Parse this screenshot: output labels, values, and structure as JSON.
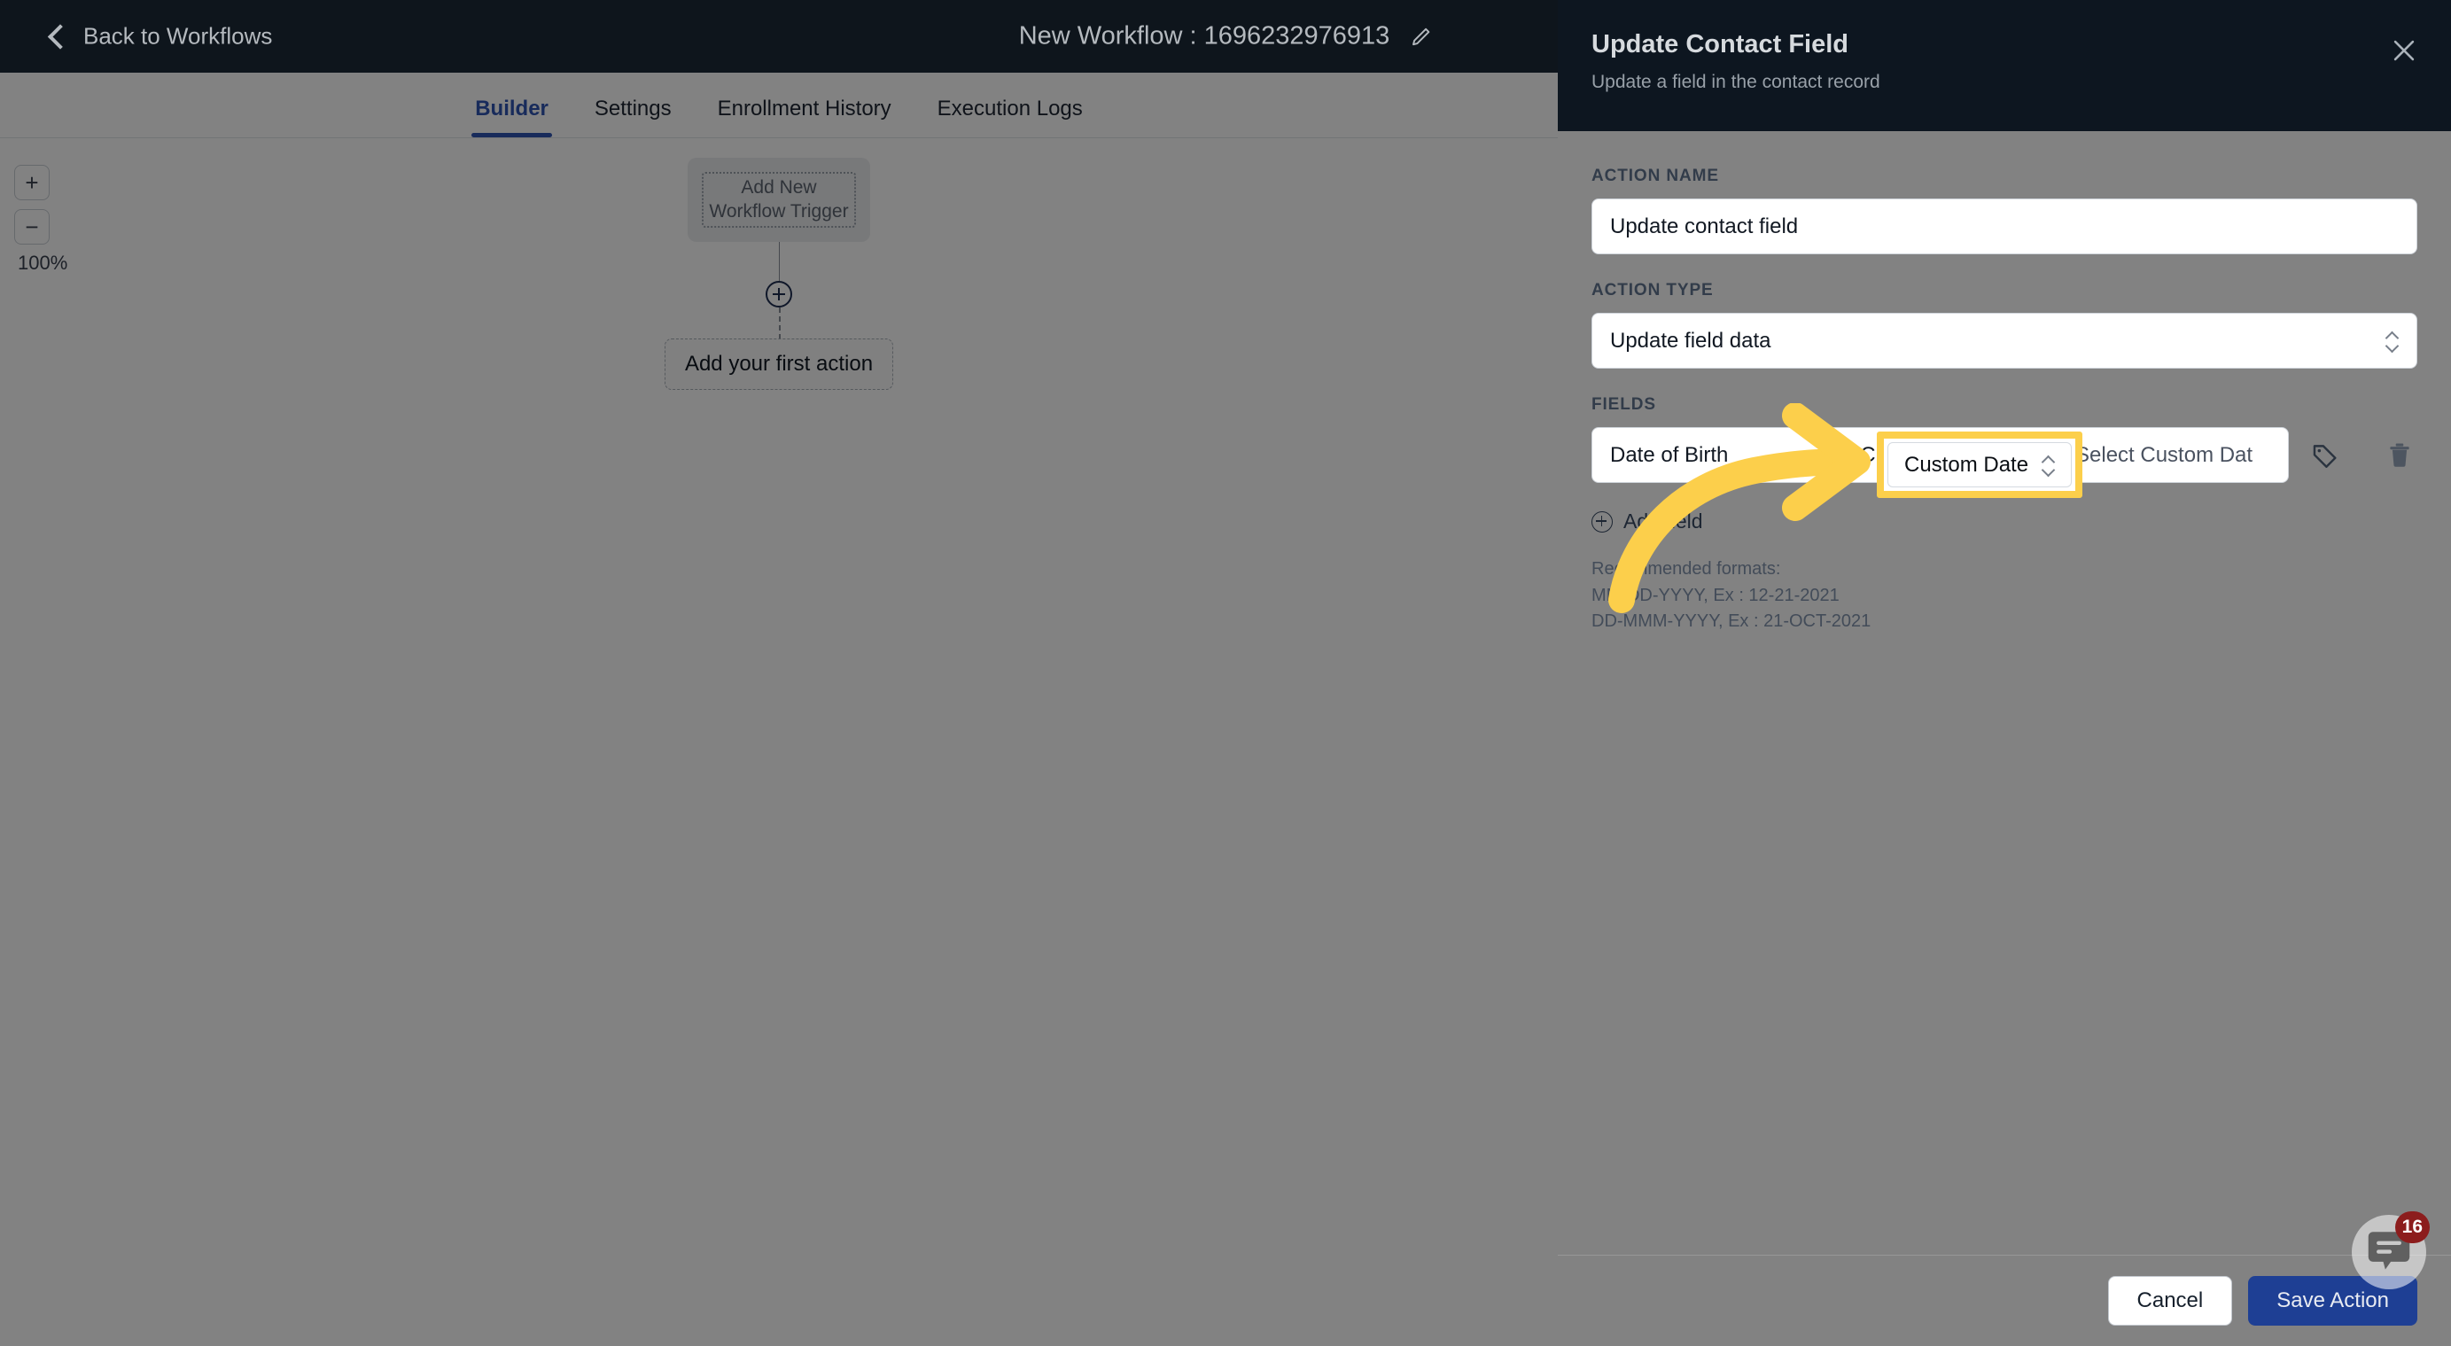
{
  "topbar": {
    "back_label": "Back to Workflows",
    "back_icon": "chevron-left-icon",
    "workflow_title": "New Workflow : 1696232976913",
    "edit_icon": "pencil-icon"
  },
  "tabs": [
    {
      "label": "Builder",
      "active": true
    },
    {
      "label": "Settings",
      "active": false
    },
    {
      "label": "Enrollment History",
      "active": false
    },
    {
      "label": "Execution Logs",
      "active": false
    }
  ],
  "canvas": {
    "zoom": {
      "plus_label": "+",
      "minus_label": "−",
      "level": "100%"
    },
    "trigger_card_label": "Add New Workflow Trigger",
    "add_node_icon": "plus-circle-icon",
    "first_action_label": "Add your first action"
  },
  "panel": {
    "title": "Update Contact Field",
    "subtitle": "Update a field in the contact record",
    "close_icon": "close-icon",
    "action_name": {
      "label": "ACTION NAME",
      "value": "Update contact field"
    },
    "action_type": {
      "label": "ACTION TYPE",
      "value": "Update field data",
      "caret_icon": "chevron-updown-icon"
    },
    "fields": {
      "label": "FIELDS",
      "row": {
        "field_name": "Date of Birth",
        "value_type": "Custom Date",
        "value_type_caret_icon": "chevron-updown-icon",
        "custom_value_placeholder": "Select Custom Dat",
        "tag_icon": "tag-icon",
        "delete_icon": "trash-icon"
      },
      "add_field_label": "Add field",
      "add_field_icon": "plus-circle-icon"
    },
    "recommended_formats": {
      "heading": "Recommended formats:",
      "line1": "MM-DD-YYYY, Ex : 12-21-2021",
      "line2": "DD-MMM-YYYY, Ex : 21-OCT-2021"
    },
    "footer": {
      "cancel_label": "Cancel",
      "save_label": "Save Action"
    }
  },
  "annotation": {
    "highlight_color": "#FCCF4B",
    "highlighted_value": "Custom Date",
    "arrow_icon": "curved-arrow-icon"
  },
  "chat_widget": {
    "icon": "chat-bubble-icon",
    "badge_count": "16"
  },
  "colors": {
    "accent_blue": "#2f55b3",
    "primary_button": "#1e3f94",
    "dark_header": "#0d1620",
    "highlight_yellow": "#FCCF4B",
    "badge_red": "#8c1d1d"
  }
}
